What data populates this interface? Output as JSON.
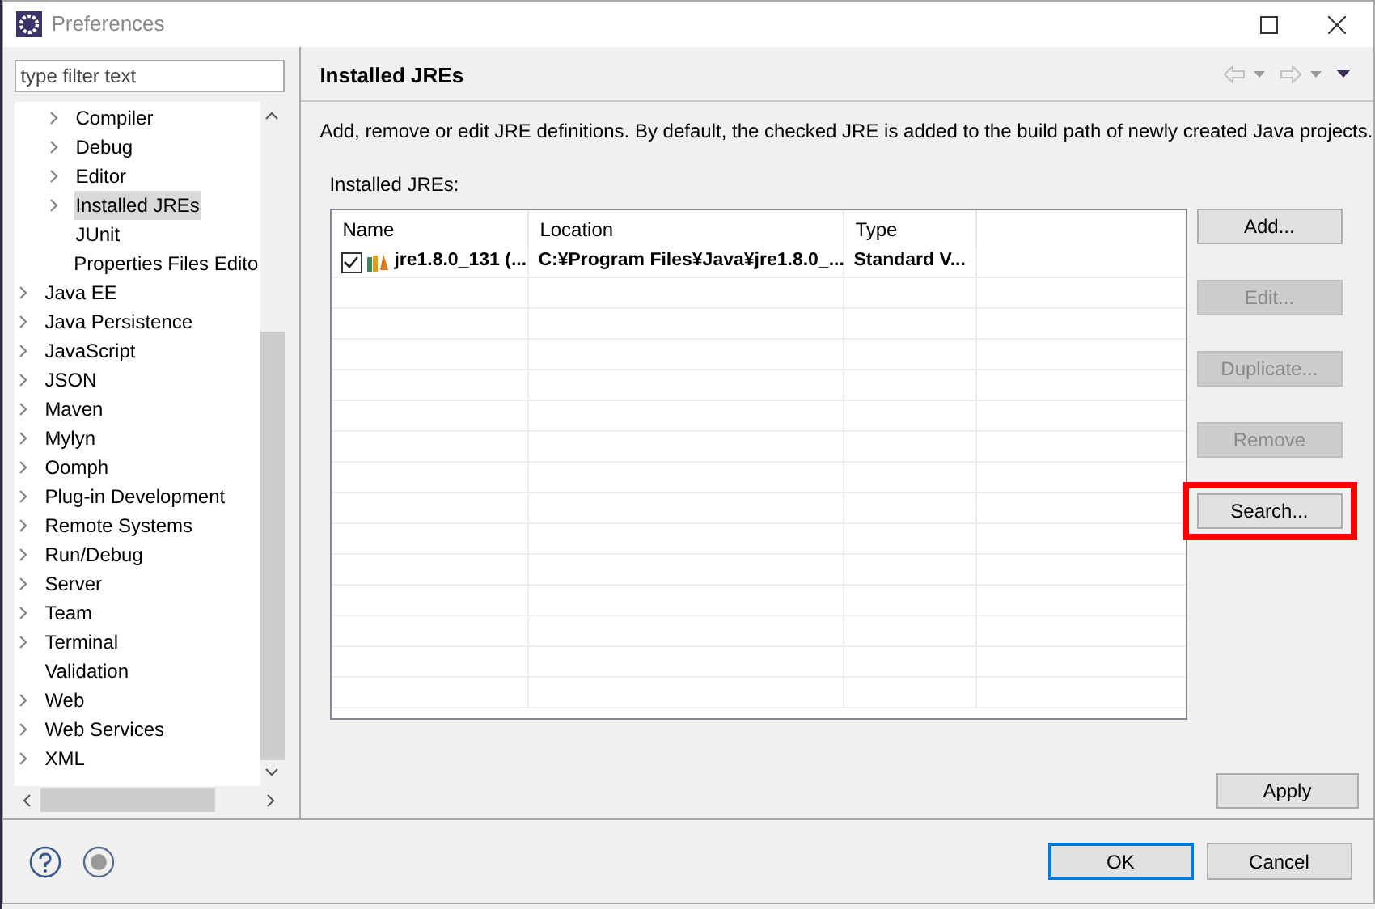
{
  "window": {
    "title": "Preferences"
  },
  "filter": {
    "placeholder": "type filter text"
  },
  "tree": {
    "nested_items": [
      {
        "label": "Compiler",
        "expandable": true,
        "selected": false
      },
      {
        "label": "Debug",
        "expandable": true,
        "selected": false
      },
      {
        "label": "Editor",
        "expandable": true,
        "selected": false
      },
      {
        "label": "Installed JREs",
        "expandable": true,
        "selected": true
      },
      {
        "label": "JUnit",
        "expandable": false,
        "selected": false
      },
      {
        "label": "Properties Files Edito",
        "expandable": false,
        "selected": false
      }
    ],
    "items": [
      {
        "label": "Java EE",
        "expandable": true,
        "selected": false
      },
      {
        "label": "Java Persistence",
        "expandable": true,
        "selected": false
      },
      {
        "label": "JavaScript",
        "expandable": true,
        "selected": false
      },
      {
        "label": "JSON",
        "expandable": true,
        "selected": false
      },
      {
        "label": "Maven",
        "expandable": true,
        "selected": false
      },
      {
        "label": "Mylyn",
        "expandable": true,
        "selected": false
      },
      {
        "label": "Oomph",
        "expandable": true,
        "selected": false
      },
      {
        "label": "Plug-in Development",
        "expandable": true,
        "selected": false
      },
      {
        "label": "Remote Systems",
        "expandable": true,
        "selected": false
      },
      {
        "label": "Run/Debug",
        "expandable": true,
        "selected": false
      },
      {
        "label": "Server",
        "expandable": true,
        "selected": false
      },
      {
        "label": "Team",
        "expandable": true,
        "selected": false
      },
      {
        "label": "Terminal",
        "expandable": true,
        "selected": false
      },
      {
        "label": "Validation",
        "expandable": false,
        "selected": false
      },
      {
        "label": "Web",
        "expandable": true,
        "selected": false
      },
      {
        "label": "Web Services",
        "expandable": true,
        "selected": false
      },
      {
        "label": "XML",
        "expandable": true,
        "selected": false
      }
    ]
  },
  "page": {
    "title": "Installed JREs",
    "description": "Add, remove or edit JRE definitions. By default, the checked JRE is added to the build path of newly created Java projects.",
    "table_label": "Installed JREs:"
  },
  "table": {
    "columns": [
      "Name",
      "Location",
      "Type"
    ],
    "rows": [
      {
        "checked": true,
        "name": "jre1.8.0_131 (...",
        "location": "C:¥Program Files¥Java¥jre1.8.0_...",
        "type": "Standard V..."
      }
    ]
  },
  "side_buttons": [
    {
      "label": "Add...",
      "disabled": false,
      "highlighted": false
    },
    {
      "label": "Edit...",
      "disabled": true,
      "highlighted": false
    },
    {
      "label": "Duplicate...",
      "disabled": true,
      "highlighted": false
    },
    {
      "label": "Remove",
      "disabled": true,
      "highlighted": false
    },
    {
      "label": "Search...",
      "disabled": false,
      "highlighted": true
    }
  ],
  "apply_button": "Apply",
  "dialog_buttons": [
    {
      "label": "OK",
      "default": true
    },
    {
      "label": "Cancel",
      "default": false
    }
  ]
}
